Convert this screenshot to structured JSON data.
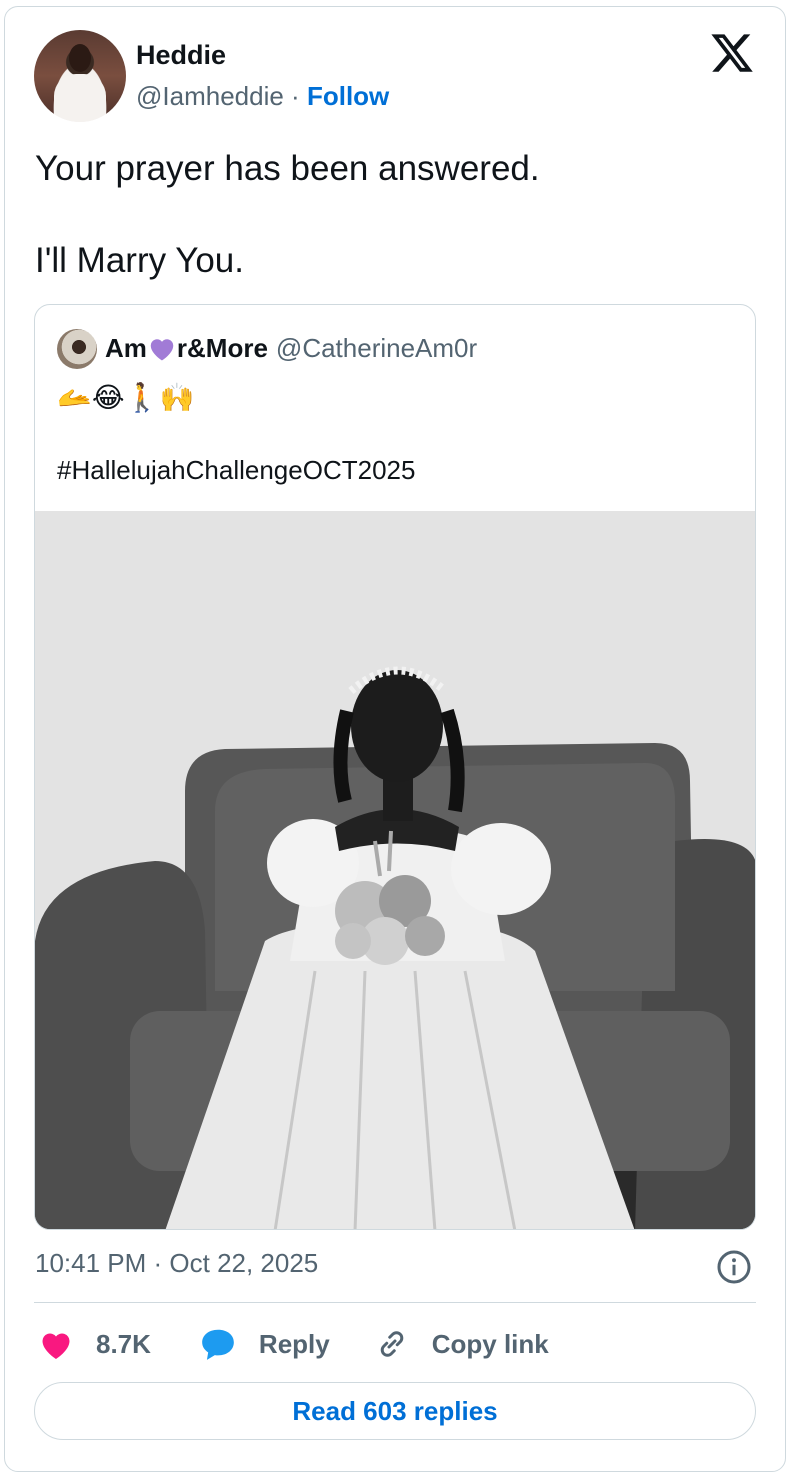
{
  "author": {
    "name": "Heddie",
    "handle": "@Iamheddie",
    "separator": "·",
    "follow_label": "Follow"
  },
  "tweet": {
    "lines": [
      "Your prayer has been answered.",
      "I'll Marry You."
    ]
  },
  "quoted": {
    "name_prefix": "Am",
    "name_suffix": "r&More",
    "handle": "@CatherineAm0r",
    "emojis": "🫴😂🚶🙌",
    "hashtag": "#HallelujahChallengeOCT2025",
    "photo_icon": "bride-photo"
  },
  "meta": {
    "timestamp": "10:41 PM · Oct 22, 2025"
  },
  "actions": {
    "like_count": "8.7K",
    "reply_label": "Reply",
    "copy_label": "Copy link",
    "read_replies_label": "Read 603 replies"
  },
  "colors": {
    "accent": "#006fd6",
    "like": "#f91880",
    "reply": "#1d9bf0",
    "border": "#cfd9de",
    "muted": "#536471",
    "heart_purple": "#a17bd6"
  }
}
